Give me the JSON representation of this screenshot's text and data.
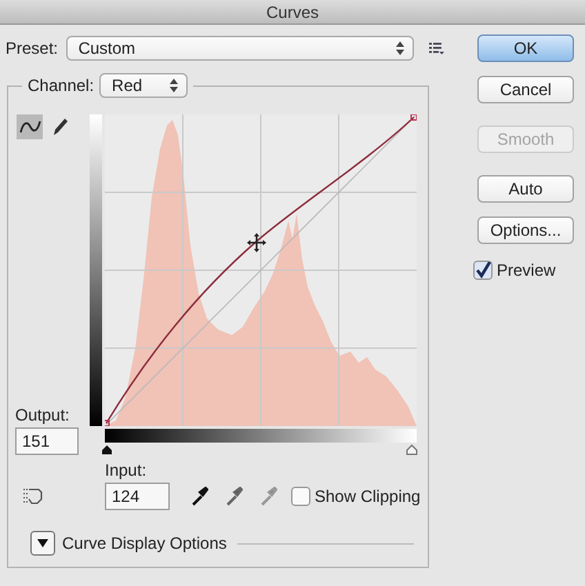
{
  "window": {
    "title": "Curves"
  },
  "preset": {
    "label": "Preset:",
    "value": "Custom"
  },
  "channel": {
    "label": "Channel:",
    "value": "Red"
  },
  "tools": [
    {
      "kind": "curve",
      "selected": true
    },
    {
      "kind": "pencil",
      "selected": false
    }
  ],
  "output": {
    "label": "Output:",
    "value": "151"
  },
  "input": {
    "label": "Input:",
    "value": "124"
  },
  "show_clipping": {
    "label": "Show Clipping",
    "checked": false
  },
  "display_options": {
    "label": "Curve Display Options",
    "expanded": false
  },
  "buttons": [
    {
      "label": "OK",
      "default": true,
      "disabled": false
    },
    {
      "label": "Cancel",
      "default": false,
      "disabled": false
    },
    {
      "label": "Smooth",
      "default": false,
      "disabled": true
    },
    {
      "label": "Auto",
      "default": false,
      "disabled": false
    },
    {
      "label": "Options...",
      "default": false,
      "disabled": false
    }
  ],
  "preview": {
    "label": "Preview",
    "checked": true
  }
}
